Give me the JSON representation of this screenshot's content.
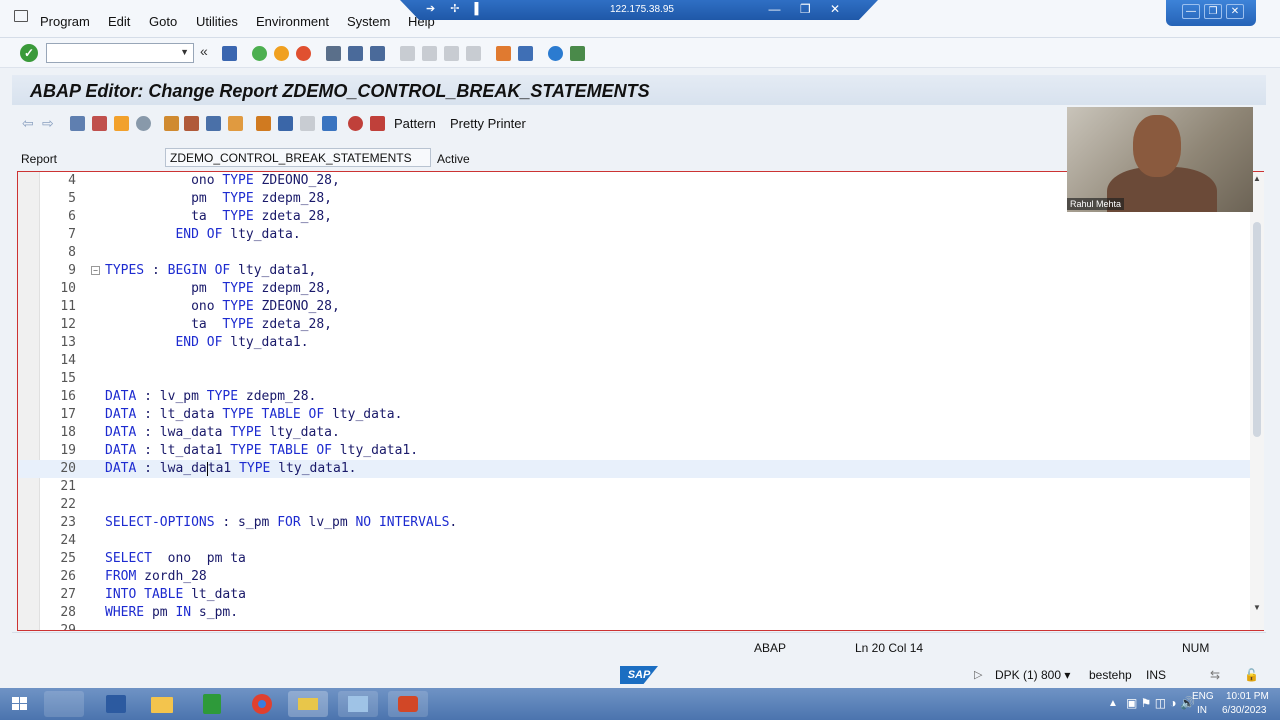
{
  "menu": [
    "Program",
    "Edit",
    "Goto",
    "Utilities",
    "Environment",
    "System",
    "Help"
  ],
  "remote": {
    "address": "122.175.38.95"
  },
  "title": "ABAP Editor: Change Report ZDEMO_CONTROL_BREAK_STATEMENTS",
  "app_toolbar": {
    "pattern_label": "Pattern",
    "pretty_printer_label": "Pretty Printer"
  },
  "report": {
    "label": "Report",
    "name": "ZDEMO_CONTROL_BREAK_STATEMENTS",
    "status": "Active"
  },
  "code": [
    {
      "ln": "4",
      "parts": [
        [
          "t",
          "           ono "
        ],
        [
          "k",
          "TYPE"
        ],
        [
          "t",
          " ZDEONO_28,"
        ]
      ]
    },
    {
      "ln": "5",
      "parts": [
        [
          "t",
          "           pm  "
        ],
        [
          "k",
          "TYPE"
        ],
        [
          "t",
          " zdepm_28,"
        ]
      ]
    },
    {
      "ln": "6",
      "parts": [
        [
          "t",
          "           ta  "
        ],
        [
          "k",
          "TYPE"
        ],
        [
          "t",
          " zdeta_28,"
        ]
      ]
    },
    {
      "ln": "7",
      "parts": [
        [
          "t",
          "         "
        ],
        [
          "k",
          "END OF"
        ],
        [
          "t",
          " lty_data."
        ]
      ]
    },
    {
      "ln": "8",
      "parts": []
    },
    {
      "ln": "9",
      "fold": true,
      "parts": [
        [
          "k",
          "TYPES"
        ],
        [
          "t",
          " : "
        ],
        [
          "k",
          "BEGIN OF"
        ],
        [
          "t",
          " lty_data1,"
        ]
      ]
    },
    {
      "ln": "10",
      "parts": [
        [
          "t",
          "           pm  "
        ],
        [
          "k",
          "TYPE"
        ],
        [
          "t",
          " zdepm_28,"
        ]
      ]
    },
    {
      "ln": "11",
      "parts": [
        [
          "t",
          "           ono "
        ],
        [
          "k",
          "TYPE"
        ],
        [
          "t",
          " ZDEONO_28,"
        ]
      ]
    },
    {
      "ln": "12",
      "parts": [
        [
          "t",
          "           ta  "
        ],
        [
          "k",
          "TYPE"
        ],
        [
          "t",
          " zdeta_28,"
        ]
      ]
    },
    {
      "ln": "13",
      "parts": [
        [
          "t",
          "         "
        ],
        [
          "k",
          "END OF"
        ],
        [
          "t",
          " lty_data1."
        ]
      ]
    },
    {
      "ln": "14",
      "parts": []
    },
    {
      "ln": "15",
      "parts": []
    },
    {
      "ln": "16",
      "parts": [
        [
          "k",
          "DATA"
        ],
        [
          "t",
          " : lv_pm "
        ],
        [
          "k",
          "TYPE"
        ],
        [
          "t",
          " zdepm_28."
        ]
      ]
    },
    {
      "ln": "17",
      "parts": [
        [
          "k",
          "DATA"
        ],
        [
          "t",
          " : lt_data "
        ],
        [
          "k",
          "TYPE TABLE OF"
        ],
        [
          "t",
          " lty_data."
        ]
      ]
    },
    {
      "ln": "18",
      "parts": [
        [
          "k",
          "DATA"
        ],
        [
          "t",
          " : lwa_data "
        ],
        [
          "k",
          "TYPE"
        ],
        [
          "t",
          " lty_data."
        ]
      ]
    },
    {
      "ln": "19",
      "parts": [
        [
          "k",
          "DATA"
        ],
        [
          "t",
          " : lt_data1 "
        ],
        [
          "k",
          "TYPE TABLE OF"
        ],
        [
          "t",
          " lty_data1."
        ]
      ]
    },
    {
      "ln": "20",
      "current": true,
      "parts": [
        [
          "k",
          "DATA"
        ],
        [
          "t",
          " : lwa_da"
        ],
        [
          "c",
          ""
        ],
        [
          "t",
          "ta1 "
        ],
        [
          "k",
          "TYPE"
        ],
        [
          "t",
          " lty_data1."
        ]
      ]
    },
    {
      "ln": "21",
      "parts": []
    },
    {
      "ln": "22",
      "parts": []
    },
    {
      "ln": "23",
      "parts": [
        [
          "k",
          "SELECT-OPTIONS"
        ],
        [
          "t",
          " : s_pm "
        ],
        [
          "k",
          "FOR"
        ],
        [
          "t",
          " lv_pm "
        ],
        [
          "k",
          "NO INTERVALS"
        ],
        [
          "t",
          "."
        ]
      ]
    },
    {
      "ln": "24",
      "parts": []
    },
    {
      "ln": "25",
      "parts": [
        [
          "k",
          "SELECT"
        ],
        [
          "t",
          "  ono  pm ta"
        ]
      ]
    },
    {
      "ln": "26",
      "parts": [
        [
          "k",
          "FROM"
        ],
        [
          "t",
          " zordh_28"
        ]
      ]
    },
    {
      "ln": "27",
      "parts": [
        [
          "k",
          "INTO TABLE"
        ],
        [
          "t",
          " lt_data"
        ]
      ]
    },
    {
      "ln": "28",
      "parts": [
        [
          "k",
          "WHERE"
        ],
        [
          "t",
          " pm "
        ],
        [
          "k",
          "IN"
        ],
        [
          "t",
          " s_pm."
        ]
      ]
    },
    {
      "ln": "29",
      "parts": []
    }
  ],
  "editor_status": {
    "language": "ABAP",
    "position": "Ln  20 Col  14",
    "num": "NUM"
  },
  "sap_footer": {
    "logo": "SAP",
    "system": "DPK (1) 800",
    "host": "bestehp",
    "mode": "INS"
  },
  "tray": {
    "lang1": "ENG",
    "lang2": "IN",
    "time": "10:01 PM",
    "date": "6/30/2023"
  },
  "webcam": {
    "name": "Rahul Mehta"
  },
  "colors": {
    "keyword": "#1d2bd0",
    "title_bg": "#dde6f1",
    "taskbar": "#5a80b8",
    "editor_border": "#cc3333"
  }
}
